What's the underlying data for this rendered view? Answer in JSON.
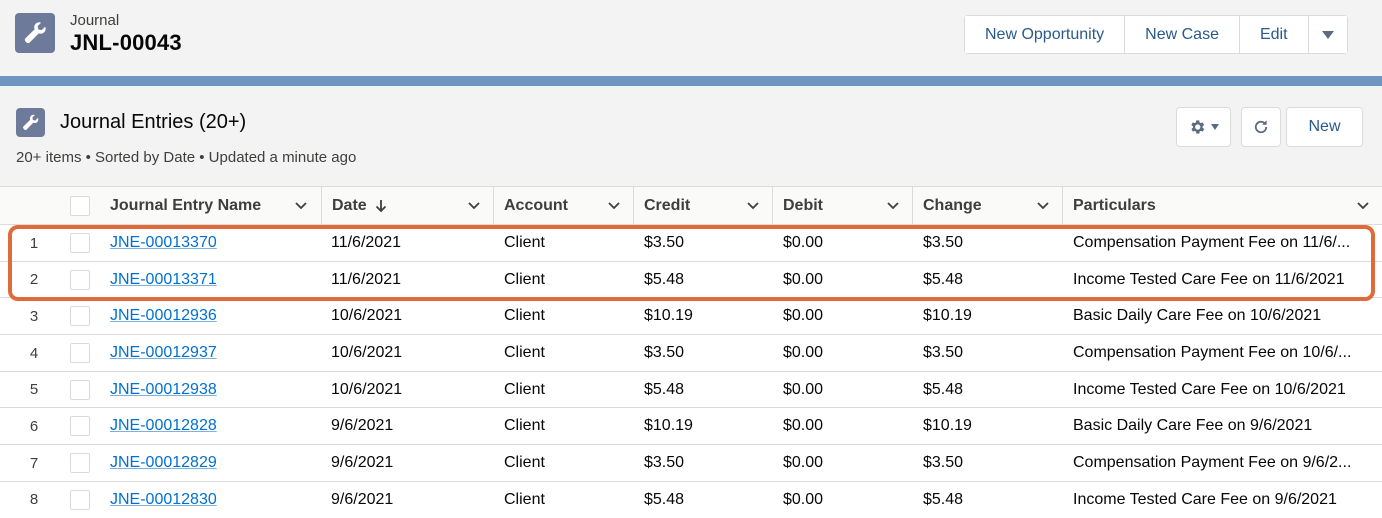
{
  "header": {
    "object_label": "Journal",
    "record_title": "JNL-00043",
    "icon": "wrench-icon",
    "actions": [
      "New Opportunity",
      "New Case",
      "Edit"
    ]
  },
  "related_list": {
    "title": "Journal Entries (20+)",
    "meta": "20+ items • Sorted by Date • Updated a minute ago",
    "new_label": "New",
    "icon": "wrench-icon"
  },
  "table": {
    "columns": [
      "Journal Entry Name",
      "Date",
      "Account",
      "Credit",
      "Debit",
      "Change",
      "Particulars"
    ],
    "sort_column": "Date",
    "sort_direction": "descending",
    "rows": [
      {
        "num": "1",
        "name": "JNE-00013370",
        "date": "11/6/2021",
        "account": "Client",
        "credit": "$3.50",
        "debit": "$0.00",
        "change": "$3.50",
        "particulars": "Compensation Payment Fee on 11/6/..."
      },
      {
        "num": "2",
        "name": "JNE-00013371",
        "date": "11/6/2021",
        "account": "Client",
        "credit": "$5.48",
        "debit": "$0.00",
        "change": "$5.48",
        "particulars": "Income Tested Care Fee on 11/6/2021"
      },
      {
        "num": "3",
        "name": "JNE-00012936",
        "date": "10/6/2021",
        "account": "Client",
        "credit": "$10.19",
        "debit": "$0.00",
        "change": "$10.19",
        "particulars": "Basic Daily Care Fee on 10/6/2021"
      },
      {
        "num": "4",
        "name": "JNE-00012937",
        "date": "10/6/2021",
        "account": "Client",
        "credit": "$3.50",
        "debit": "$0.00",
        "change": "$3.50",
        "particulars": "Compensation Payment Fee on 10/6/..."
      },
      {
        "num": "5",
        "name": "JNE-00012938",
        "date": "10/6/2021",
        "account": "Client",
        "credit": "$5.48",
        "debit": "$0.00",
        "change": "$5.48",
        "particulars": "Income Tested Care Fee on 10/6/2021"
      },
      {
        "num": "6",
        "name": "JNE-00012828",
        "date": "9/6/2021",
        "account": "Client",
        "credit": "$10.19",
        "debit": "$0.00",
        "change": "$10.19",
        "particulars": "Basic Daily Care Fee on 9/6/2021"
      },
      {
        "num": "7",
        "name": "JNE-00012829",
        "date": "9/6/2021",
        "account": "Client",
        "credit": "$3.50",
        "debit": "$0.00",
        "change": "$3.50",
        "particulars": "Compensation Payment Fee on 9/6/2..."
      },
      {
        "num": "8",
        "name": "JNE-00012830",
        "date": "9/6/2021",
        "account": "Client",
        "credit": "$5.48",
        "debit": "$0.00",
        "change": "$5.48",
        "particulars": "Income Tested Care Fee on 9/6/2021"
      }
    ]
  },
  "colors": {
    "brand_band": "#6f95c1",
    "link": "#0070d2",
    "highlight": "#e06b3a"
  }
}
